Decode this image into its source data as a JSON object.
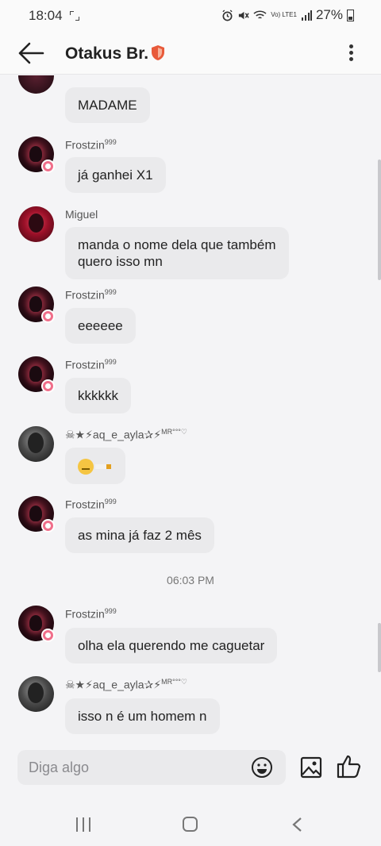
{
  "status_bar": {
    "time": "18:04",
    "network": "Vo) LTE1",
    "battery": "27%"
  },
  "header": {
    "title": "Otakus Br."
  },
  "messages_partial": {
    "text": "MADAME"
  },
  "messages": [
    {
      "sender": "Frostzin",
      "sender_suffix": "999",
      "text": "já ganhei X1"
    },
    {
      "sender": "Miguel",
      "line1": "manda o nome dela que também",
      "line2": "quero isso mn"
    },
    {
      "sender": "Frostzin",
      "sender_suffix": "999",
      "text": "eeeeee"
    },
    {
      "sender": "Frostzin",
      "sender_suffix": "999",
      "text": "kkkkkk"
    },
    {
      "sender": "☠★⚡aq_e_ayla✰⚡",
      "sender_suffix": "MR°°°♡",
      "text": ""
    },
    {
      "sender": "Frostzin",
      "sender_suffix": "999",
      "text": "as mina já faz 2 mês"
    },
    {
      "sender": "Frostzin",
      "sender_suffix": "999",
      "text": "olha ela querendo me caguetar"
    },
    {
      "sender": "☠★⚡aq_e_ayla✰⚡",
      "sender_suffix": "MR°°°♡",
      "text": "isso n é um homem n"
    }
  ],
  "timestamp": "06:03 PM",
  "composer": {
    "placeholder": "Diga algo"
  }
}
